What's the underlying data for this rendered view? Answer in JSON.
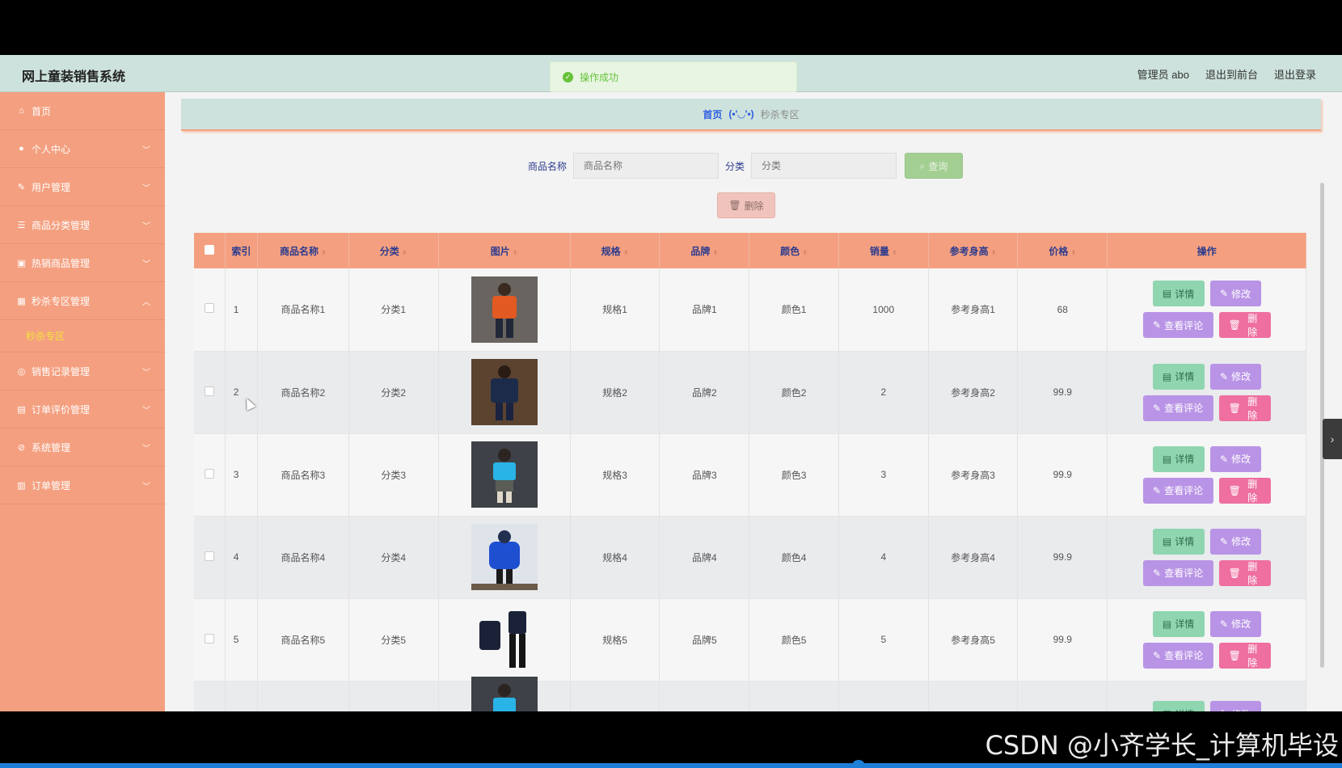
{
  "app": {
    "title": "网上童装销售系统",
    "admin_label": "管理员 abo",
    "exit_front": "退出到前台",
    "logout": "退出登录"
  },
  "toast": {
    "message": "操作成功"
  },
  "sidebar": {
    "items": [
      {
        "label": "首页",
        "icon": "home-icon"
      },
      {
        "label": "个人中心",
        "icon": "user-icon"
      },
      {
        "label": "用户管理",
        "icon": "edit-icon"
      },
      {
        "label": "商品分类管理",
        "icon": "list-icon"
      },
      {
        "label": "热销商品管理",
        "icon": "image-icon"
      },
      {
        "label": "秒杀专区管理",
        "icon": "grid-icon"
      },
      {
        "label": "销售记录管理",
        "icon": "compass-icon"
      },
      {
        "label": "订单评价管理",
        "icon": "clipboard-icon"
      },
      {
        "label": "系统管理",
        "icon": "bell-off-icon"
      },
      {
        "label": "订单管理",
        "icon": "order-icon"
      }
    ],
    "sub_item": "秒杀专区"
  },
  "breadcrumb": {
    "home": "首页",
    "face": "(•'◡'•)",
    "current": "秒杀专区"
  },
  "search": {
    "name_label": "商品名称",
    "name_placeholder": "商品名称",
    "category_label": "分类",
    "category_placeholder": "分类",
    "query_button": "查询",
    "delete_button": "删除"
  },
  "table": {
    "headers": [
      "索引",
      "商品名称",
      "分类",
      "图片",
      "规格",
      "品牌",
      "颜色",
      "销量",
      "参考身高",
      "价格",
      "操作"
    ],
    "rows": [
      {
        "index": "1",
        "name": "商品名称1",
        "category": "分类1",
        "spec": "规格1",
        "brand": "品牌1",
        "color": "颜色1",
        "sales": "1000",
        "height": "参考身高1",
        "price": "68"
      },
      {
        "index": "2",
        "name": "商品名称2",
        "category": "分类2",
        "spec": "规格2",
        "brand": "品牌2",
        "color": "颜色2",
        "sales": "2",
        "height": "参考身高2",
        "price": "99.9"
      },
      {
        "index": "3",
        "name": "商品名称3",
        "category": "分类3",
        "spec": "规格3",
        "brand": "品牌3",
        "color": "颜色3",
        "sales": "3",
        "height": "参考身高3",
        "price": "99.9"
      },
      {
        "index": "4",
        "name": "商品名称4",
        "category": "分类4",
        "spec": "规格4",
        "brand": "品牌4",
        "color": "颜色4",
        "sales": "4",
        "height": "参考身高4",
        "price": "99.9"
      },
      {
        "index": "5",
        "name": "商品名称5",
        "category": "分类5",
        "spec": "规格5",
        "brand": "品牌5",
        "color": "颜色5",
        "sales": "5",
        "height": "参考身高5",
        "price": "99.9"
      },
      {
        "index": "",
        "name": "",
        "category": "",
        "spec": "",
        "brand": "",
        "color": "",
        "sales": "",
        "height": "",
        "price": ""
      }
    ],
    "actions": {
      "detail": "详情",
      "edit": "修改",
      "comments": "查看评论",
      "delete": "删除"
    }
  },
  "watermark": "CSDN @小齐学长_计算机毕设",
  "colors": {
    "accent": "#f4a080",
    "header": "#cde2dc",
    "link": "#2d5ee0"
  }
}
